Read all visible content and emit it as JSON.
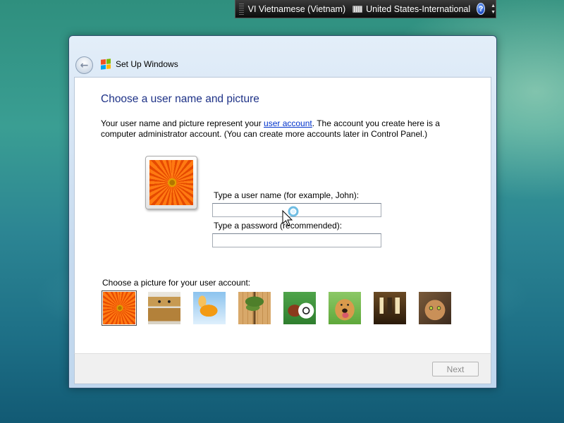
{
  "language_bar": {
    "input_language": "VI Vietnamese (Vietnam)",
    "keyboard_layout": "United States-International",
    "help_glyph": "?",
    "icons": [
      "keyboard-icon",
      "help-icon",
      "options-arrows-icon"
    ]
  },
  "window": {
    "title": "Set Up Windows",
    "back_glyph": "←"
  },
  "page": {
    "heading": "Choose a user name and picture",
    "intro_before_link": "Your user name and picture represent your ",
    "intro_link": "user account",
    "intro_after_link": ". The account you create here is a computer administrator account. (You can create more accounts later in Control Panel.)"
  },
  "form": {
    "username_label": "Type a user name (for example, John):",
    "username_value": "",
    "password_label": "Type a password (recommended):",
    "password_value": ""
  },
  "pictures": {
    "label": "Choose a picture for your user account:",
    "selected": "flower",
    "items": [
      "flower",
      "robot",
      "fish",
      "bonsai tree",
      "football",
      "dog",
      "chess pieces",
      "kitten"
    ]
  },
  "footer": {
    "next_label": "Next",
    "next_enabled": false
  },
  "colors": {
    "heading": "#1e3287",
    "link": "#0033cc",
    "disabled_text": "#8d8d8d"
  }
}
